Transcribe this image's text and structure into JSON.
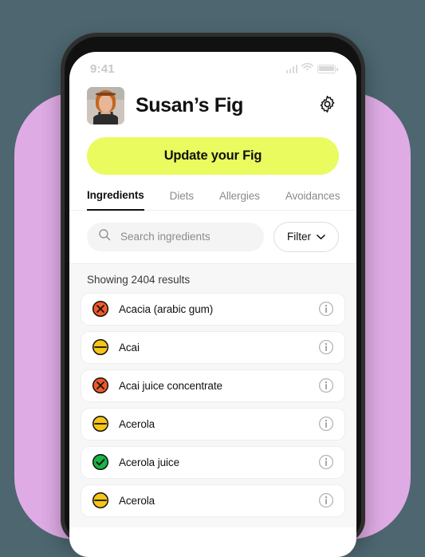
{
  "theme": {
    "backdrop_color": "#4d6670",
    "accent_shape_color": "#dfabe5",
    "cta_color": "#e9fb5e",
    "status_avoid_color": "#f05a28",
    "status_caution_color": "#f5c518",
    "status_ok_color": "#17b544"
  },
  "status_bar": {
    "time": "9:41",
    "signal_icon": "cellular-signal-icon",
    "wifi_icon": "wifi-icon",
    "battery_icon": "battery-icon"
  },
  "header": {
    "avatar_alt": "user-avatar-photo",
    "title": "Susan’s Fig",
    "settings_icon": "gear-icon"
  },
  "cta": {
    "label": "Update your Fig"
  },
  "tabs": [
    {
      "label": "Ingredients",
      "active": true
    },
    {
      "label": "Diets",
      "active": false
    },
    {
      "label": "Allergies",
      "active": false
    },
    {
      "label": "Avoidances",
      "active": false
    }
  ],
  "search": {
    "icon": "search-icon",
    "placeholder": "Search ingredients",
    "value": ""
  },
  "filter": {
    "label": "Filter",
    "icon": "chevron-down-icon"
  },
  "results": {
    "count_text": "Showing 2404 results",
    "items": [
      {
        "name": "Acacia (arabic gum)",
        "status": "avoid",
        "status_icon": "circle-x-icon",
        "info_icon": "info-icon"
      },
      {
        "name": "Acai",
        "status": "caution",
        "status_icon": "circle-minus-icon",
        "info_icon": "info-icon"
      },
      {
        "name": "Acai juice concentrate",
        "status": "avoid",
        "status_icon": "circle-x-icon",
        "info_icon": "info-icon"
      },
      {
        "name": "Acerola",
        "status": "caution",
        "status_icon": "circle-minus-icon",
        "info_icon": "info-icon"
      },
      {
        "name": "Acerola juice",
        "status": "ok",
        "status_icon": "circle-check-icon",
        "info_icon": "info-icon"
      },
      {
        "name": "Acerola",
        "status": "caution",
        "status_icon": "circle-minus-icon",
        "info_icon": "info-icon"
      }
    ]
  }
}
